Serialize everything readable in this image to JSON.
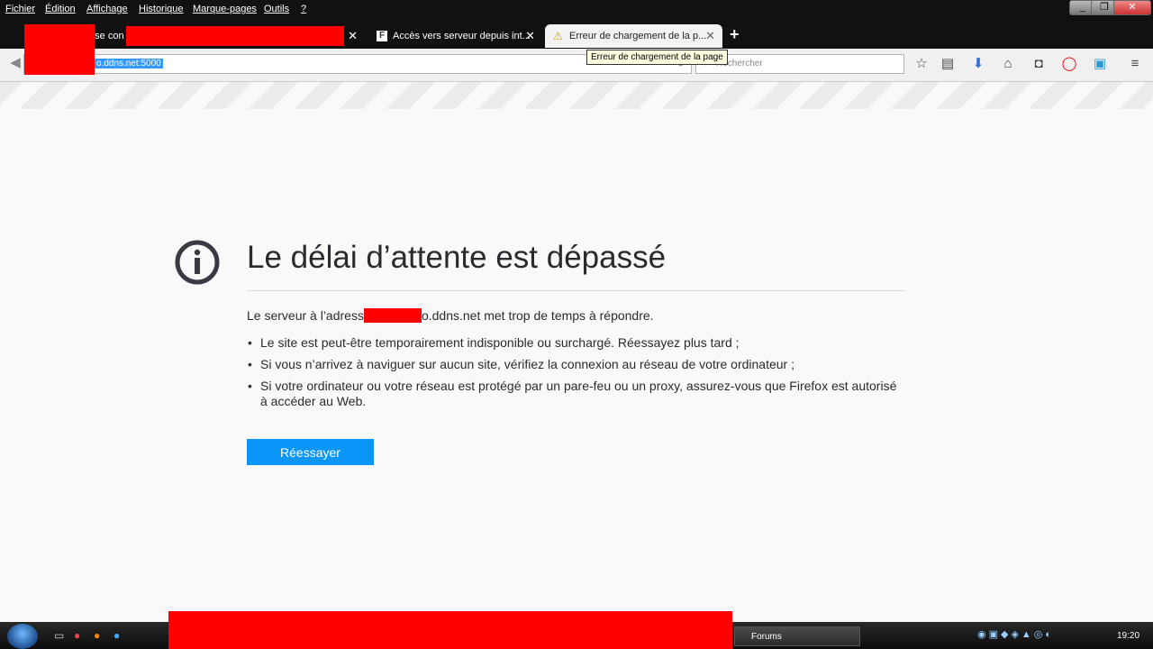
{
  "menu": [
    "Fichier",
    "Édition",
    "Affichage",
    "Historique",
    "Marque-pages",
    "Outils",
    "?"
  ],
  "window_controls": {
    "minimize": "_",
    "restore": "❐",
    "close": "✕"
  },
  "tabs": [
    {
      "label": "e se con",
      "close": "✕"
    },
    {
      "label": "Accès vers serveur depuis int...",
      "close": "✕"
    },
    {
      "label": "Erreur de chargement de la p...",
      "close": "✕"
    }
  ],
  "new_tab": "+",
  "url_visible": "o.ddns.net:5000",
  "search_placeholder": "Rechercher",
  "tooltip": "Erreur de chargement de la page",
  "error": {
    "title": "Le délai d’attente est dépassé",
    "description_prefix": "Le serveur à l’adress",
    "description_suffix": "o.ddns.net met trop de temps à répondre.",
    "bullets": [
      "Le site est peut-être temporairement indisponible ou surchargé. Réessayez plus tard ;",
      "Si vous n’arrivez à naviguer sur aucun site, vérifiez la connexion au réseau de votre ordinateur ;",
      "Si votre ordinateur ou votre réseau est protégé par un pare-feu ou un proxy, assurez-vous que Firefox est autorisé à accéder au Web."
    ],
    "retry_label": "Réessayer"
  },
  "taskbar": {
    "task_label": "Forums",
    "clock": "19:20"
  },
  "colors": {
    "accent_button": "#0996f8",
    "redaction": "#ff0000",
    "chrome_bg": "#111111"
  },
  "icons": [
    "back-icon",
    "reload-icon",
    "bookmark-star-icon",
    "reading-list-icon",
    "download-icon",
    "home-icon",
    "pocket-icon",
    "opera-icon",
    "notification-icon",
    "menu-icon",
    "info-icon",
    "warning-icon"
  ]
}
